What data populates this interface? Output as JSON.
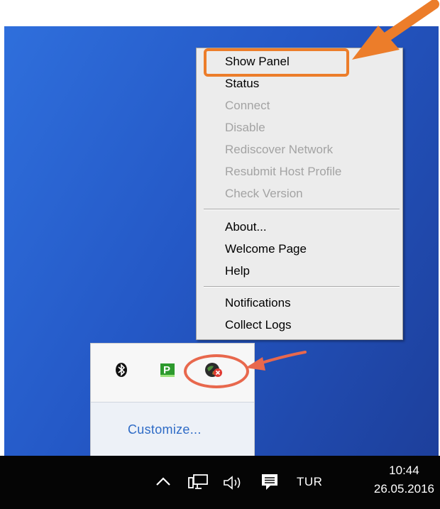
{
  "context_menu": {
    "items": [
      {
        "label": "Show Panel",
        "enabled": true
      },
      {
        "label": "Status",
        "enabled": true
      },
      {
        "label": "Connect",
        "enabled": false
      },
      {
        "label": "Disable",
        "enabled": false
      },
      {
        "label": "Rediscover Network",
        "enabled": false
      },
      {
        "label": "Resubmit Host Profile",
        "enabled": false
      },
      {
        "label": "Check Version",
        "enabled": false
      },
      {
        "label": "About...",
        "enabled": true
      },
      {
        "label": "Welcome Page",
        "enabled": true
      },
      {
        "label": "Help",
        "enabled": true
      },
      {
        "label": "Notifications",
        "enabled": true
      },
      {
        "label": "Collect Logs",
        "enabled": true
      }
    ]
  },
  "tray_flyout": {
    "icons": [
      "bluetooth-icon",
      "green-p-app-icon",
      "globe-error-icon"
    ],
    "customize_label": "Customize..."
  },
  "taskbar": {
    "icons": [
      "chevron-up-icon",
      "network-icon",
      "volume-icon",
      "action-center-icon"
    ],
    "language": "TUR",
    "time": "10:44",
    "date": "26.05.2016"
  },
  "annotations": {
    "arrow_color_top": "#ec7d2a",
    "arrow_color_bottom": "#e8684d"
  },
  "colors": {
    "desktop": "#2458c6",
    "taskbar": "#050505",
    "menu_bg": "#ececec",
    "disabled_text": "#a3a3a3",
    "link": "#2e6bc6"
  }
}
